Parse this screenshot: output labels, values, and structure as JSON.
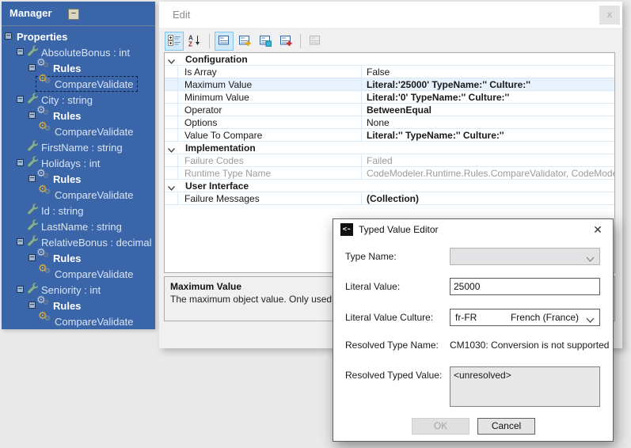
{
  "icons": {
    "tree_collapse": "−",
    "tree_expander": "−",
    "edit_close": "x",
    "dialog_close": "✕",
    "dialog_app_icon": "<-"
  },
  "tree": {
    "title": "Manager",
    "items": [
      {
        "label": "Properties",
        "level": 0,
        "bold": true,
        "expander": true
      },
      {
        "label": "AbsoluteBonus : int",
        "level": 1,
        "icon": "wrench-icon",
        "expander": true
      },
      {
        "label": "Rules",
        "level": 2,
        "bold": true,
        "icon": "gears-icon",
        "expander": true
      },
      {
        "label": "CompareValidate",
        "level": 3,
        "icon": "gold-gears-icon",
        "selected": true
      },
      {
        "label": "City : string",
        "level": 1,
        "icon": "wrench-icon",
        "expander": true
      },
      {
        "label": "Rules",
        "level": 2,
        "bold": true,
        "icon": "gears-icon",
        "expander": true
      },
      {
        "label": "CompareValidate",
        "level": 3,
        "icon": "gold-gears-icon"
      },
      {
        "label": "FirstName : string",
        "level": 1,
        "icon": "wrench-icon"
      },
      {
        "label": "Holidays : int",
        "level": 1,
        "icon": "wrench-icon",
        "expander": true
      },
      {
        "label": "Rules",
        "level": 2,
        "bold": true,
        "icon": "gears-icon",
        "expander": true
      },
      {
        "label": "CompareValidate",
        "level": 3,
        "icon": "gold-gears-icon"
      },
      {
        "label": "Id : string",
        "level": 1,
        "icon": "wrench-icon"
      },
      {
        "label": "LastName : string",
        "level": 1,
        "icon": "wrench-icon"
      },
      {
        "label": "RelativeBonus : decimal",
        "level": 1,
        "icon": "wrench-icon",
        "expander": true
      },
      {
        "label": "Rules",
        "level": 2,
        "bold": true,
        "icon": "gears-icon",
        "expander": true
      },
      {
        "label": "CompareValidate",
        "level": 3,
        "icon": "gold-gears-icon"
      },
      {
        "label": "Seniority : int",
        "level": 1,
        "icon": "wrench-icon",
        "expander": true
      },
      {
        "label": "Rules",
        "level": 2,
        "bold": true,
        "icon": "gears-icon",
        "expander": true
      },
      {
        "label": "CompareValidate",
        "level": 3,
        "icon": "gold-gears-icon"
      }
    ]
  },
  "edit_panel": {
    "title": "Edit",
    "toolbar": [
      {
        "name": "categorized-view-button",
        "icon": "categorized-icon",
        "selected": true
      },
      {
        "name": "alphabetical-sort-button",
        "icon": "alphabetical-sort-icon"
      },
      {
        "separator": true
      },
      {
        "name": "show-properties-button",
        "icon": "property-page-icon",
        "selected": true
      },
      {
        "name": "add-property-button",
        "icon": "property-page-add-icon"
      },
      {
        "name": "copy-property-button",
        "icon": "property-page-copy-icon"
      },
      {
        "name": "add-rule-button",
        "icon": "property-page-add-red-icon"
      },
      {
        "separator": true
      },
      {
        "name": "property-pages-button",
        "icon": "property-pages-icon",
        "disabled": true
      }
    ],
    "grid": {
      "rows": [
        {
          "type": "category",
          "label": "Configuration"
        },
        {
          "type": "prop",
          "name": "Is Array",
          "value": "False"
        },
        {
          "type": "prop",
          "name": "Maximum Value",
          "value": "Literal:'25000' TypeName:'' Culture:''",
          "bold": true,
          "selected": true
        },
        {
          "type": "prop",
          "name": "Minimum Value",
          "value": "Literal:'0' TypeName:'' Culture:''",
          "bold": true
        },
        {
          "type": "prop",
          "name": "Operator",
          "value": "BetweenEqual",
          "bold": true
        },
        {
          "type": "prop",
          "name": "Options",
          "value": "None"
        },
        {
          "type": "prop",
          "name": "Value To Compare",
          "value": "Literal:'' TypeName:'' Culture:''",
          "bold": true
        },
        {
          "type": "category",
          "label": "Implementation"
        },
        {
          "type": "prop",
          "name": "Failure Codes",
          "value": "Failed",
          "readonly": true
        },
        {
          "type": "prop",
          "name": "Runtime Type Name",
          "value": "CodeModeler.Runtime.Rules.CompareValidator, CodeModeler.Runtime",
          "readonly": true
        },
        {
          "type": "category",
          "label": "User Interface"
        },
        {
          "type": "prop",
          "name": "Failure Messages",
          "value": "(Collection)",
          "bold": true
        }
      ]
    },
    "description": {
      "title": "Maximum Value",
      "text": "The maximum object value. Only used for bi"
    }
  },
  "dialog": {
    "title": "Typed Value Editor",
    "fields": {
      "type_name": {
        "label": "Type Name:",
        "value": ""
      },
      "literal_value": {
        "label": "Literal Value:",
        "value": "25000"
      },
      "literal_value_culture": {
        "label": "Literal Value Culture:",
        "code": "fr-FR",
        "display": "French (France)"
      },
      "resolved_type_name": {
        "label": "Resolved Type Name:",
        "value": "CM1030: Conversion is not supported"
      },
      "resolved_typed_value": {
        "label": "Resolved Typed Value:",
        "value": "<unresolved>"
      }
    },
    "buttons": {
      "ok": "OK",
      "cancel": "Cancel"
    }
  }
}
